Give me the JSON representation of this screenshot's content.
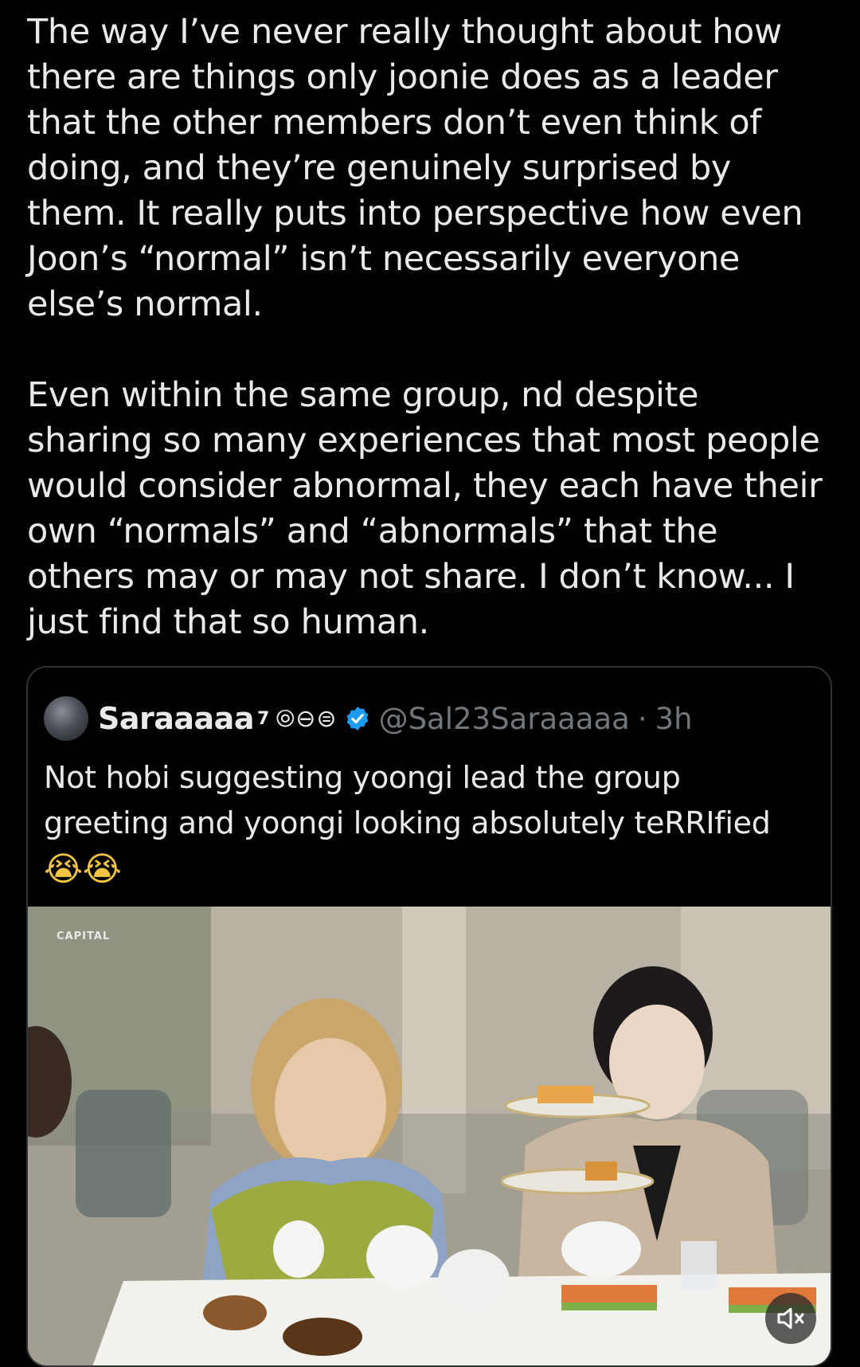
{
  "tweet": {
    "paragraphs": [
      "The way I’ve never really thought about how\nthere are things only joonie does as a leader\nthat the other members don’t even think of\ndoing, and they’re genuinely surprised by\nthem. It really puts into perspective how even\nJoon’s “normal” isn’t necessarily everyone\nelse’s normal.",
      "Even within the same group, nd despite\nsharing so many experiences that most people\nwould consider abnormal, they each have their\nown “normals” and “abnormals” that the\nothers may or may not share. I don’t know... I\njust find that so human."
    ]
  },
  "quote": {
    "display_name": "Saraaaaa",
    "name_superscript": "7",
    "name_emojis": "⦾⊖⊜",
    "handle": "@Sal23Saraaaaa",
    "separator": "·",
    "time": "3h",
    "text": "Not hobi suggesting yoongi lead the group\ngreeting and yoongi looking absolutely teRRIfied",
    "emojis": "😭😭",
    "media": {
      "watermark": "CAPITAL",
      "mute_icon": "speaker-muted-icon"
    }
  },
  "colors": {
    "background": "#000000",
    "text": "#e7e9ea",
    "muted": "#71767b",
    "border": "#2f3336",
    "verified": "#1d9bf0"
  }
}
